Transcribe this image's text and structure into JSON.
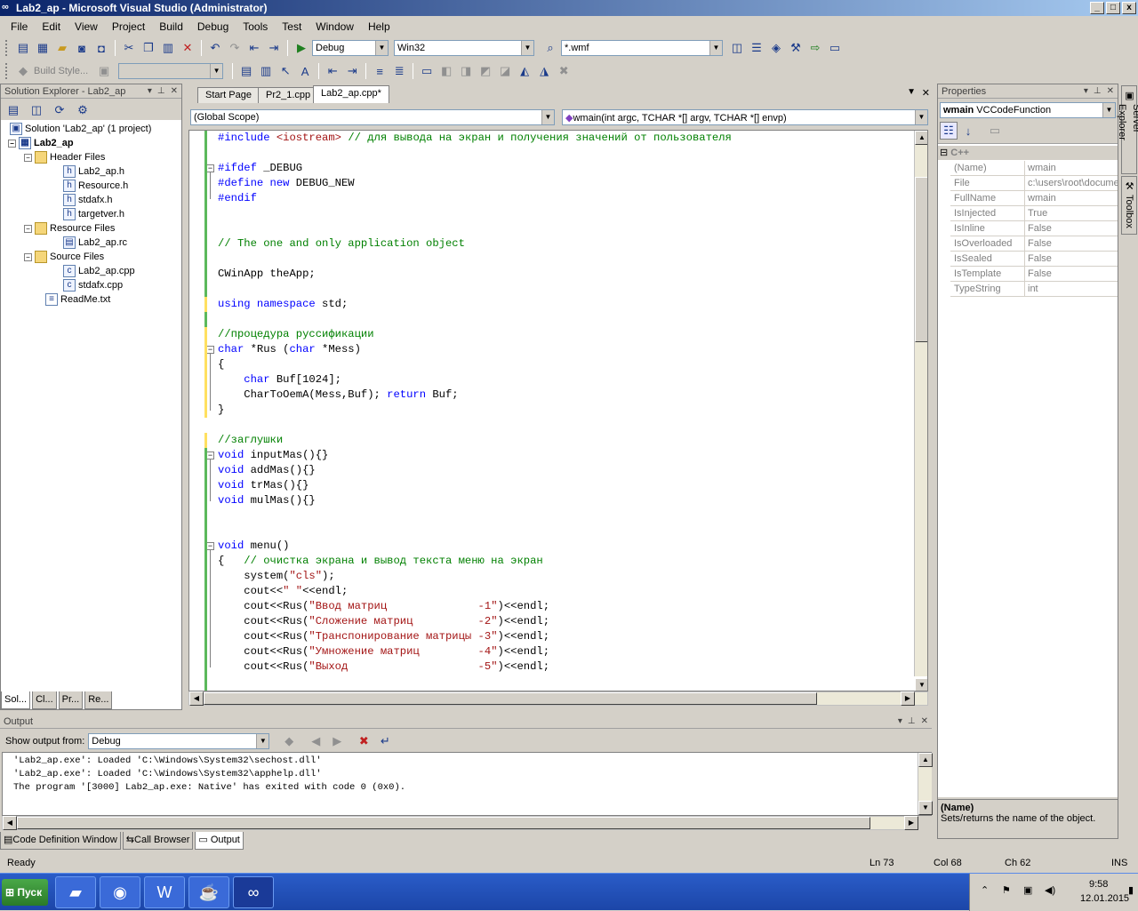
{
  "window": {
    "title": "Lab2_ap - Microsoft Visual Studio (Administrator)",
    "min": "_",
    "max": "□",
    "close": "x"
  },
  "menu": [
    "File",
    "Edit",
    "View",
    "Project",
    "Build",
    "Debug",
    "Tools",
    "Test",
    "Window",
    "Help"
  ],
  "toolbar1": {
    "config": "Debug",
    "platform": "Win32",
    "find": "*.wmf"
  },
  "toolbar2": {
    "build_style": "Build Style..."
  },
  "solution_explorer": {
    "title": "Solution Explorer - Lab2_ap",
    "solution": "Solution 'Lab2_ap' (1 project)",
    "project": "Lab2_ap",
    "header_files": "Header Files",
    "headers": [
      "Lab2_ap.h",
      "Resource.h",
      "stdafx.h",
      "targetver.h"
    ],
    "resource_files": "Resource Files",
    "resources": [
      "Lab2_ap.rc"
    ],
    "source_files": "Source Files",
    "sources": [
      "Lab2_ap.cpp",
      "stdafx.cpp"
    ],
    "readme": "ReadMe.txt",
    "tabs": [
      "Sol...",
      "Cl...",
      "Pr...",
      "Re..."
    ]
  },
  "editor": {
    "tabs": [
      "Start Page",
      "Pr2_1.cpp",
      "Lab2_ap.cpp*"
    ],
    "scope": "(Global Scope)",
    "member": "wmain(int argc, TCHAR *[] argv, TCHAR *[] envp)"
  },
  "code": [
    {
      "t": "#include <iostream> // для вывода на экран и получения значений от пользователя"
    },
    {
      "t": ""
    },
    {
      "t": "#ifdef _DEBUG"
    },
    {
      "t": "#define new DEBUG_NEW"
    },
    {
      "t": "#endif"
    },
    {
      "t": ""
    },
    {
      "t": ""
    },
    {
      "t": "// The one and only application object"
    },
    {
      "t": ""
    },
    {
      "t": "CWinApp theApp;"
    },
    {
      "t": ""
    },
    {
      "t": "using namespace std;"
    },
    {
      "t": ""
    },
    {
      "t": "//процедура руссификации"
    },
    {
      "t": "char *Rus (char *Mess)"
    },
    {
      "t": "{"
    },
    {
      "t": "    char Buf[1024];"
    },
    {
      "t": "    CharToOemA(Mess,Buf); return Buf;"
    },
    {
      "t": "}"
    },
    {
      "t": ""
    },
    {
      "t": "//заглушки"
    },
    {
      "t": "void inputMas(){}"
    },
    {
      "t": "void addMas(){}"
    },
    {
      "t": "void trMas(){}"
    },
    {
      "t": "void mulMas(){}"
    },
    {
      "t": ""
    },
    {
      "t": ""
    },
    {
      "t": "void menu()"
    },
    {
      "t": "{   // очистка экрана и вывод текста меню на экран"
    },
    {
      "t": "    system(\"cls\");"
    },
    {
      "t": "    cout<<\" \"<<endl;"
    },
    {
      "t": "    cout<<Rus(\"Ввод матриц              -1\")<<endl;"
    },
    {
      "t": "    cout<<Rus(\"Сложение матриц          -2\")<<endl;"
    },
    {
      "t": "    cout<<Rus(\"Транспонирование матрицы -3\")<<endl;"
    },
    {
      "t": "    cout<<Rus(\"Умножение матриц         -4\")<<endl;"
    },
    {
      "t": "    cout<<Rus(\"Выход                    -5\")<<endl;"
    }
  ],
  "properties": {
    "title": "Properties",
    "object": "wmain",
    "object_type": "VCCodeFunction",
    "category": "C++",
    "rows": [
      {
        "name": "(Name)",
        "value": "wmain"
      },
      {
        "name": "File",
        "value": "c:\\users\\root\\docume"
      },
      {
        "name": "FullName",
        "value": "wmain"
      },
      {
        "name": "IsInjected",
        "value": "True"
      },
      {
        "name": "IsInline",
        "value": "False"
      },
      {
        "name": "IsOverloaded",
        "value": "False"
      },
      {
        "name": "IsSealed",
        "value": "False"
      },
      {
        "name": "IsTemplate",
        "value": "False"
      },
      {
        "name": "TypeString",
        "value": "int"
      }
    ],
    "desc_title": "(Name)",
    "desc_text": "Sets/returns the name of the object."
  },
  "right_tabs": [
    "Server Explorer",
    "Toolbox"
  ],
  "output": {
    "title": "Output",
    "show_from_label": "Show output from:",
    "show_from": "Debug",
    "lines": [
      "'Lab2_ap.exe': Loaded 'C:\\Windows\\System32\\sechost.dll'",
      "'Lab2_ap.exe': Loaded 'C:\\Windows\\System32\\apphelp.dll'",
      "The program '[3000] Lab2_ap.exe: Native' has exited with code 0 (0x0)."
    ],
    "tabs": [
      "Code Definition Window",
      "Call Browser",
      "Output"
    ]
  },
  "status": {
    "state": "Ready",
    "ln": "Ln 73",
    "col": "Col 68",
    "ch": "Ch 62",
    "ins": "INS"
  },
  "taskbar": {
    "start": "Пуск",
    "time": "9:58",
    "date": "12.01.2015"
  }
}
